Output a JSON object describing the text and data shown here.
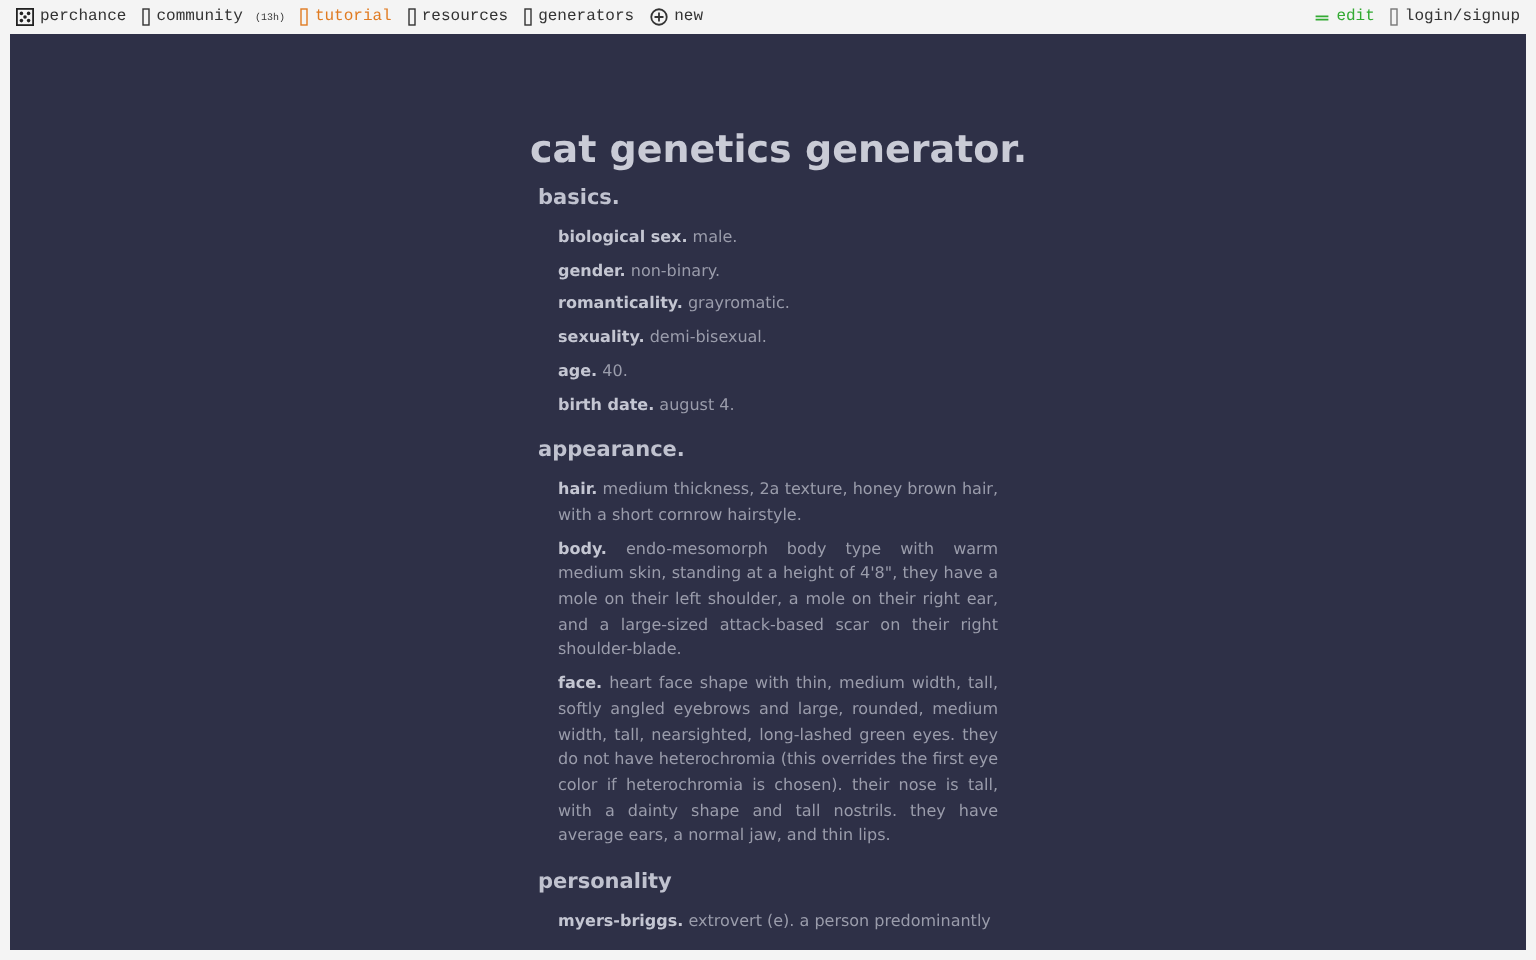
{
  "nav": {
    "brand": "perchance",
    "items": [
      {
        "label": "community",
        "badge": "(13h)",
        "selected": false
      },
      {
        "label": "tutorial",
        "selected": true
      },
      {
        "label": "resources",
        "selected": false
      },
      {
        "label": "generators",
        "selected": false
      },
      {
        "label": "new",
        "kind": "new",
        "selected": false
      }
    ],
    "right": [
      {
        "label": "edit",
        "kind": "edit"
      },
      {
        "label": "login/signup",
        "kind": "link"
      }
    ]
  },
  "title": "cat genetics generator.",
  "sections": [
    {
      "heading": "basics.",
      "items": [
        {
          "label": "biological sex.",
          "value": "male."
        },
        {
          "label": "gender.",
          "value": "non-binary."
        },
        {
          "label": "romanticality.",
          "value": "grayromatic."
        },
        {
          "label": "sexuality.",
          "value": "demi-bisexual."
        },
        {
          "label": "age.",
          "value": "40."
        },
        {
          "label": "birth date.",
          "value": "august 4."
        }
      ]
    },
    {
      "heading": "appearance.",
      "items": [
        {
          "label": "hair.",
          "value": "medium thickness, 2a texture, honey brown hair, with a short cornrow hairstyle."
        },
        {
          "label": "body.",
          "value": "endo-mesomorph body type with warm medium skin, standing at a height of 4'8\", they have a mole on their left shoulder, a mole on their right ear, and a large-sized attack-based scar on their right shoulder-blade."
        },
        {
          "label": "face.",
          "value": "heart face shape with thin, medium width, tall, softly angled eyebrows and large, rounded, medium width, tall, nearsighted, long-lashed green eyes. they do not have heterochromia (this overrides the first eye color if heterochromia is chosen). their nose is tall, with a dainty shape and tall nostrils. they have average ears, a normal jaw, and thin lips."
        }
      ]
    },
    {
      "heading": "personality",
      "items": [
        {
          "label": "myers-briggs.",
          "value": "extrovert (e). a person predominantly"
        }
      ]
    }
  ]
}
